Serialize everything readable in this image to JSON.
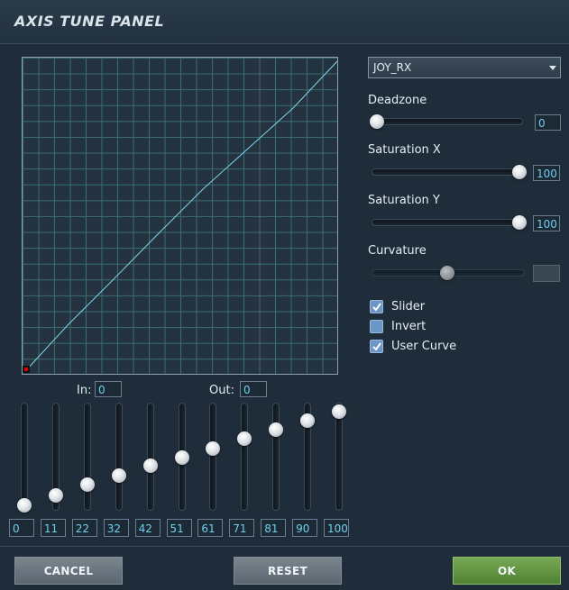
{
  "window": {
    "title": "AXIS TUNE PANEL"
  },
  "axis_select": {
    "value": "JOY_RX"
  },
  "deadzone": {
    "label": "Deadzone",
    "value": "0"
  },
  "saturation_x": {
    "label": "Saturation X",
    "value": "100"
  },
  "saturation_y": {
    "label": "Saturation Y",
    "value": "100"
  },
  "curvature": {
    "label": "Curvature",
    "value": "",
    "enabled": false
  },
  "options": [
    {
      "label": "Slider",
      "checked": true
    },
    {
      "label": "Invert",
      "checked": false
    },
    {
      "label": "User Curve",
      "checked": true
    }
  ],
  "io": {
    "in_label": "In:",
    "in_value": "0",
    "out_label": "Out:",
    "out_value": "0"
  },
  "curve_points": [
    "0",
    "11",
    "22",
    "32",
    "42",
    "51",
    "61",
    "71",
    "81",
    "90",
    "100"
  ],
  "buttons": {
    "cancel": "CANCEL",
    "reset": "RESET",
    "ok": "OK"
  },
  "colors": {
    "accent_green": "#5e9440",
    "curve_line": "#7fd6f0",
    "grid": "#3b6e73",
    "marker": "#e00000"
  }
}
